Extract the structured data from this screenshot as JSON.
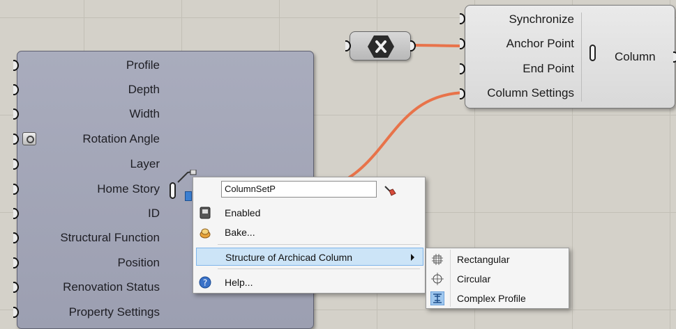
{
  "colors": {
    "canvas": "#d4d1c9",
    "wire": "#e8734a",
    "component_fill": "#a9acbd",
    "menu_highlight": "#cce4f7",
    "menu_highlight_border": "#7eb4ea"
  },
  "left_component": {
    "inputs": [
      {
        "label": "Profile"
      },
      {
        "label": "Depth"
      },
      {
        "label": "Width"
      },
      {
        "label": "Rotation Angle"
      },
      {
        "label": "Layer"
      },
      {
        "label": "Home Story"
      },
      {
        "label": "ID"
      },
      {
        "label": "Structural Function"
      },
      {
        "label": "Position"
      },
      {
        "label": "Renovation Status"
      },
      {
        "label": "Property Settings"
      }
    ]
  },
  "hex_node": {
    "icon": "hexagon-cross-icon"
  },
  "column_component": {
    "inputs": [
      {
        "label": "Synchronize"
      },
      {
        "label": "Anchor Point"
      },
      {
        "label": "End Point"
      },
      {
        "label": "Column Settings"
      }
    ],
    "output": "Column"
  },
  "context_menu": {
    "name_value": "ColumnSetP",
    "items": {
      "enabled": "Enabled",
      "bake": "Bake...",
      "structure": "Structure of Archicad Column",
      "help": "Help..."
    }
  },
  "submenu": {
    "items": [
      {
        "label": "Rectangular",
        "icon": "rectangular-profile-icon",
        "selected": false
      },
      {
        "label": "Circular",
        "icon": "circular-profile-icon",
        "selected": false
      },
      {
        "label": "Complex Profile",
        "icon": "complex-profile-icon",
        "selected": true
      }
    ]
  }
}
